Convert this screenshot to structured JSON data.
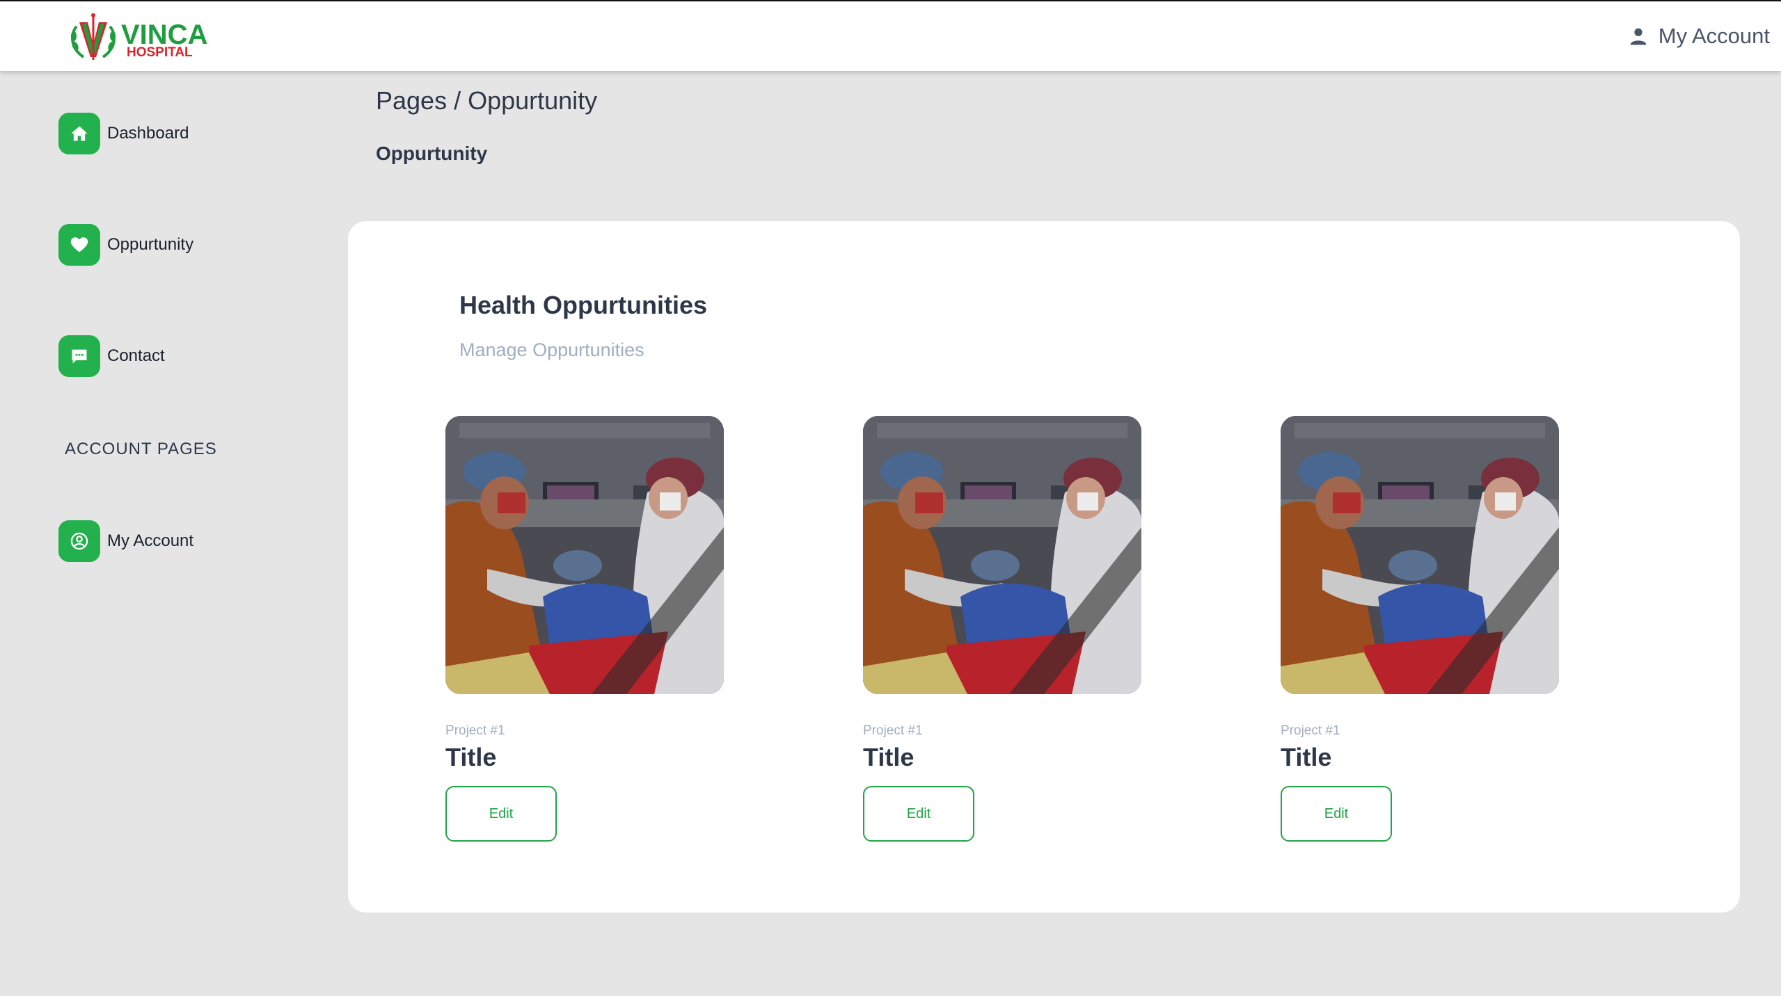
{
  "brand": {
    "name": "VINCA",
    "subname": "HOSPITAL",
    "green": "#1f9d3f",
    "red": "#d7262f"
  },
  "header": {
    "account_label": "My Account",
    "account_icon": "person-icon"
  },
  "sidebar": {
    "accent": "#22b14c",
    "items": [
      {
        "label": "Dashboard",
        "icon": "home-icon"
      },
      {
        "label": "Oppurtunity",
        "icon": "heart-icon"
      },
      {
        "label": "Contact",
        "icon": "chat-icon"
      }
    ],
    "section_label": "ACCOUNT PAGES",
    "account_items": [
      {
        "label": "My Account",
        "icon": "user-circle-icon"
      }
    ]
  },
  "page": {
    "breadcrumb": "Pages / Oppurtunity",
    "title": "Oppurtunity"
  },
  "card": {
    "title": "Health Oppurtunities",
    "subtitle": "Manage Oppurtunities",
    "projects": [
      {
        "tag": "Project #1",
        "title": "Title",
        "button": "Edit"
      },
      {
        "tag": "Project #1",
        "title": "Title",
        "button": "Edit"
      },
      {
        "tag": "Project #1",
        "title": "Title",
        "button": "Edit"
      }
    ]
  }
}
